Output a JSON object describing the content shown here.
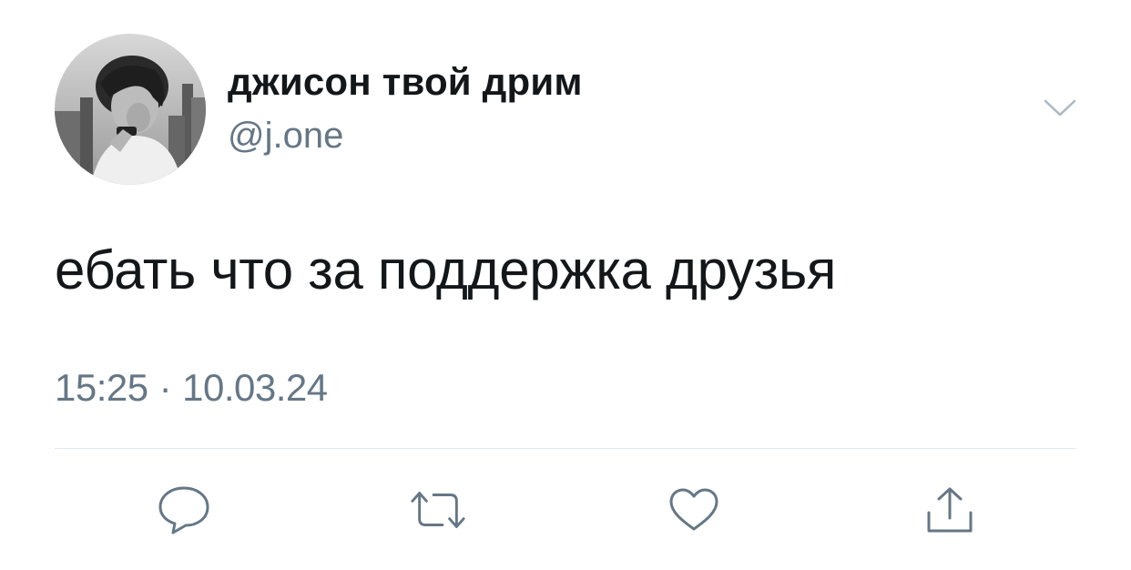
{
  "author": {
    "display_name": "джисон твой дрим",
    "handle": "@j.one",
    "avatar_icon": "avatar-photo"
  },
  "tweet": {
    "text": "ебать что за поддержка друзья",
    "time": "15:25",
    "separator": "·",
    "date": "10.03.24"
  },
  "actions": [
    {
      "name": "reply",
      "icon": "speech-bubble-icon"
    },
    {
      "name": "retweet",
      "icon": "retweet-arrows-icon"
    },
    {
      "name": "like",
      "icon": "heart-icon"
    },
    {
      "name": "share",
      "icon": "share-upload-icon"
    }
  ],
  "colors": {
    "text": "#14171a",
    "secondary": "#657786",
    "divider": "#e1e8ed",
    "icon": "#657786"
  }
}
